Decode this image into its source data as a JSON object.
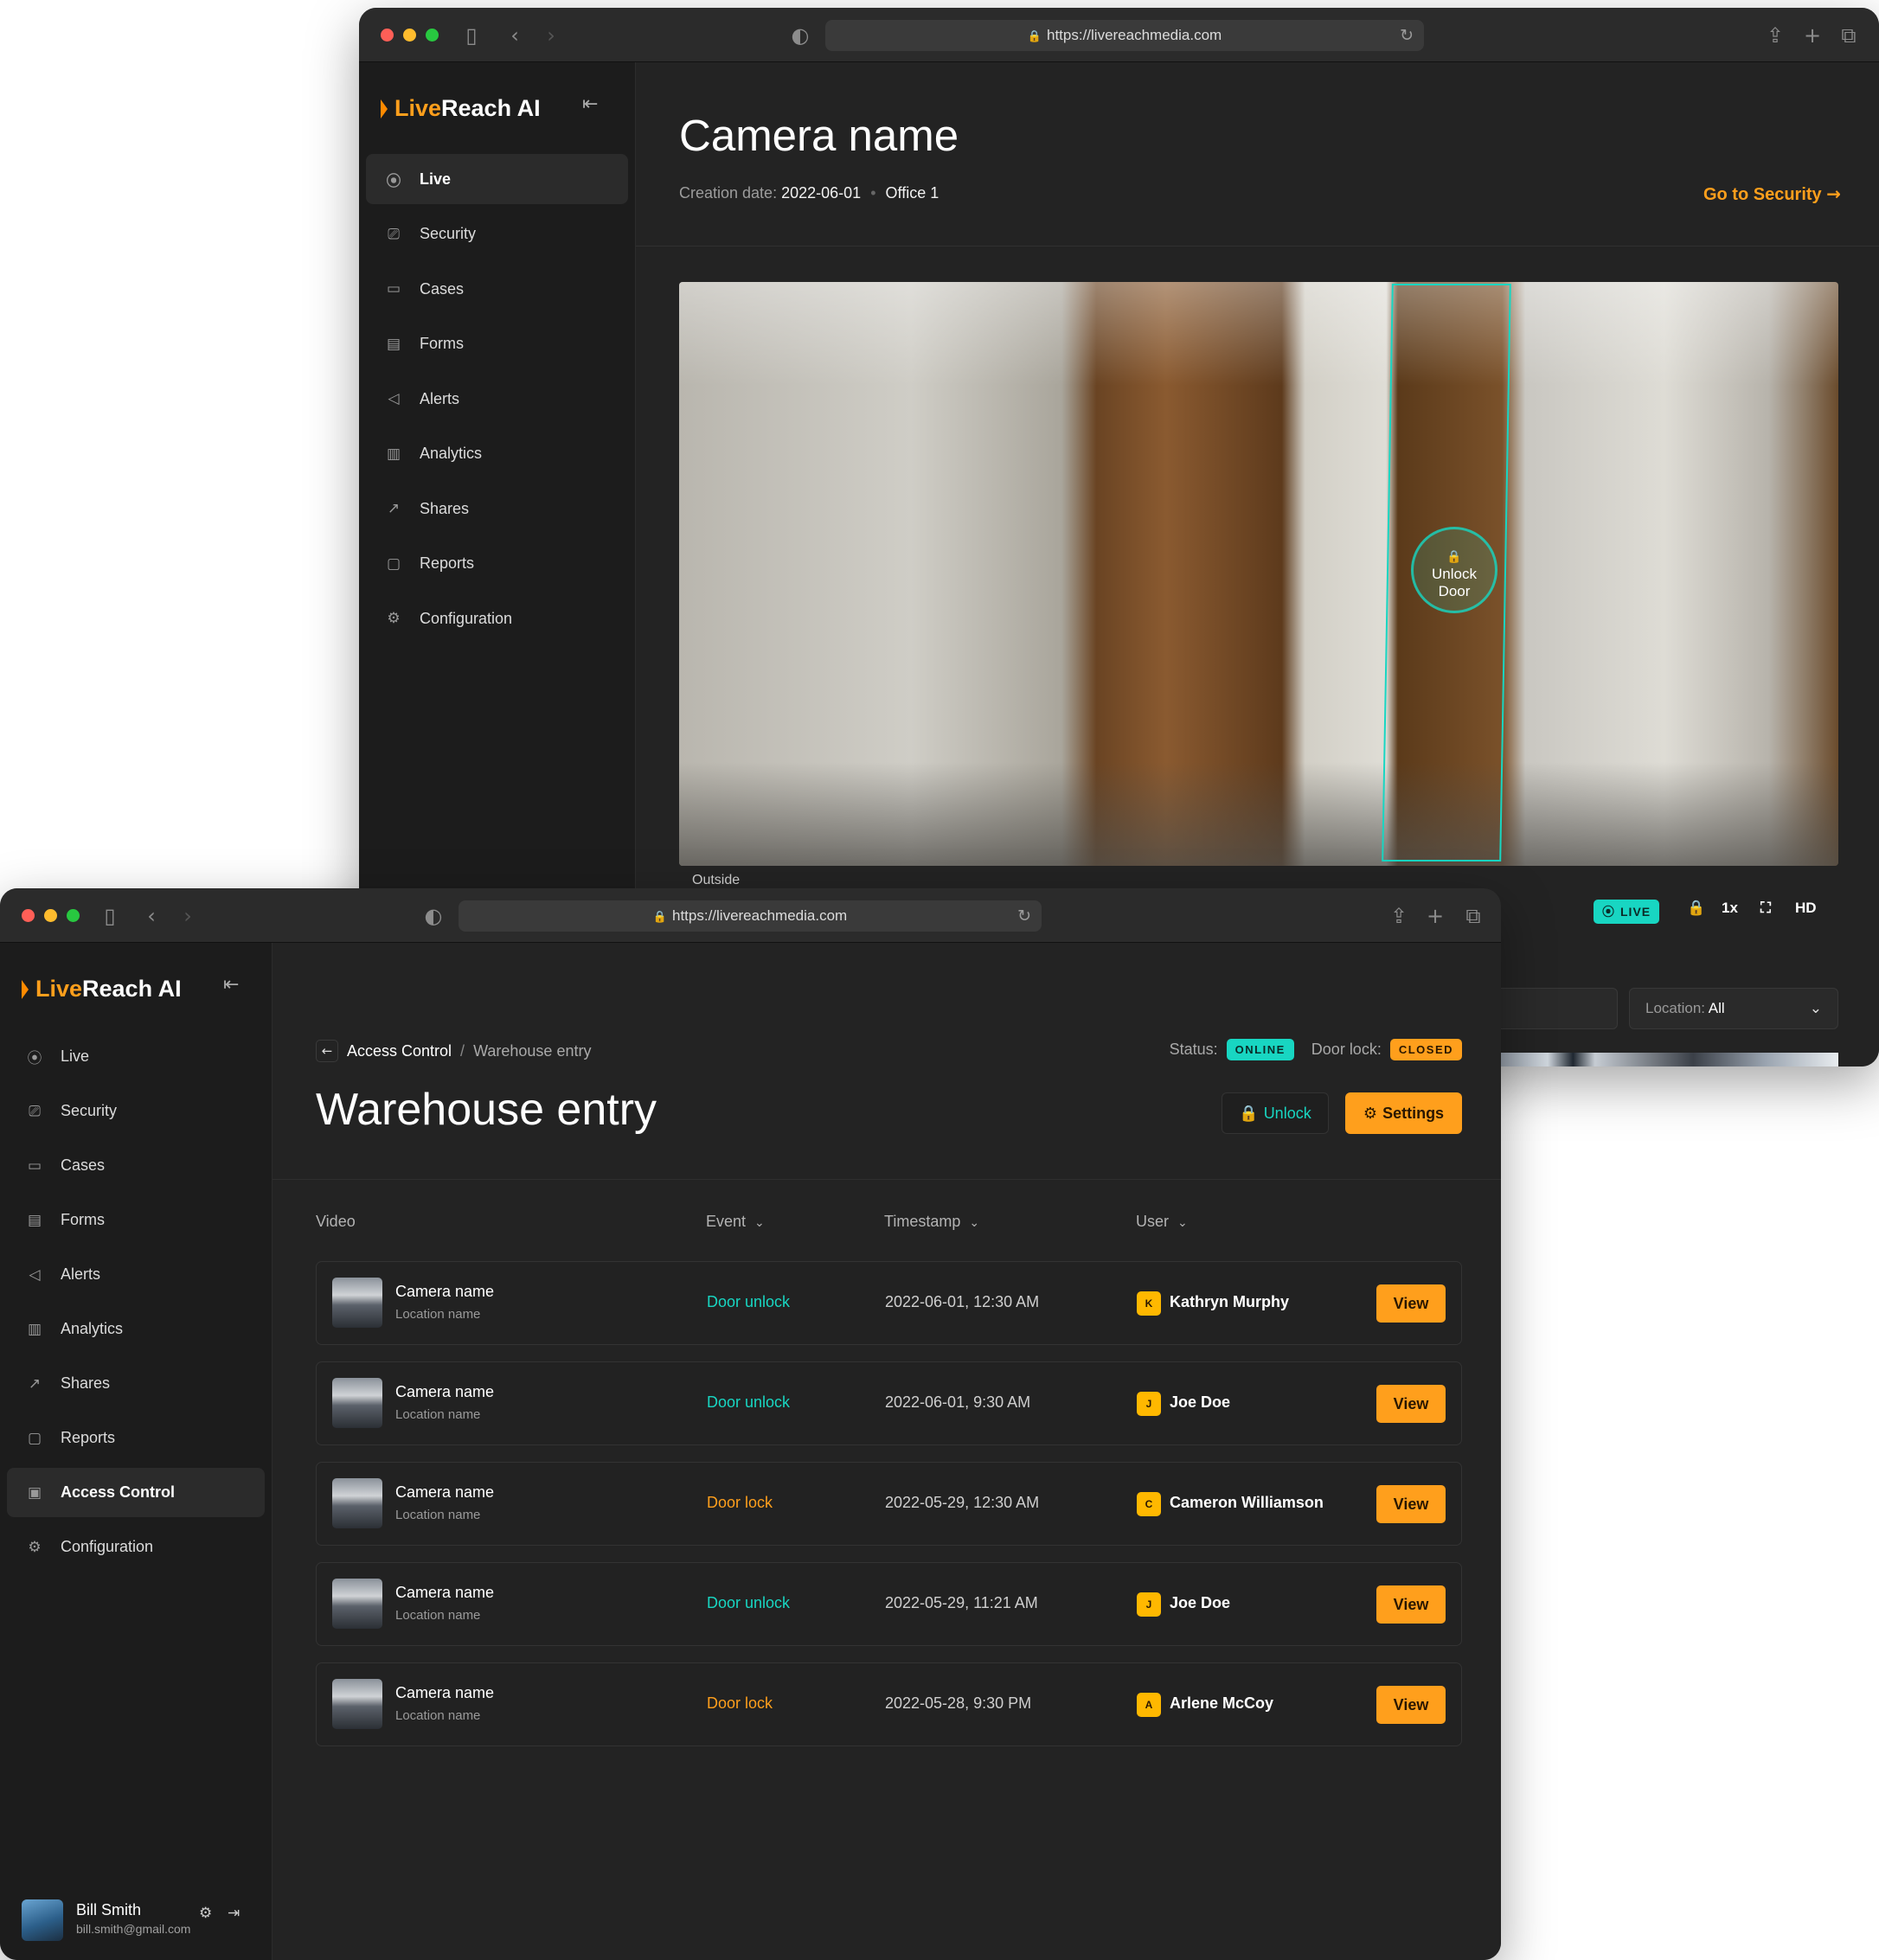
{
  "back_window": {
    "url": "https://livereachmedia.com",
    "brand_prefix": "Live",
    "brand_suffix": "Reach AI",
    "nav": [
      {
        "label": "Live",
        "icon": "live-icon"
      },
      {
        "label": "Security",
        "icon": "camera-icon"
      },
      {
        "label": "Cases",
        "icon": "folder-icon"
      },
      {
        "label": "Forms",
        "icon": "form-icon"
      },
      {
        "label": "Alerts",
        "icon": "megaphone-icon"
      },
      {
        "label": "Analytics",
        "icon": "bar-chart-icon"
      },
      {
        "label": "Shares",
        "icon": "share-icon"
      },
      {
        "label": "Reports",
        "icon": "report-icon"
      },
      {
        "label": "Configuration",
        "icon": "gear-icon"
      }
    ],
    "active_nav": "Live",
    "title": "Camera name",
    "creation_label": "Creation date:",
    "creation_date": "2022-06-01",
    "office": "Office 1",
    "go_security": "Go to Security",
    "unlock_overlay_line1": "Unlock",
    "unlock_overlay_line2": "Door",
    "camera_label": "Outside",
    "controls": {
      "live": "LIVE",
      "speed": "1x",
      "quality": "HD"
    },
    "location_filter_label": "Location:",
    "location_filter_value": "All"
  },
  "front_window": {
    "url": "https://livereachmedia.com",
    "brand_prefix": "Live",
    "brand_suffix": "Reach AI",
    "nav": [
      {
        "label": "Live",
        "icon": "live-icon"
      },
      {
        "label": "Security",
        "icon": "camera-icon"
      },
      {
        "label": "Cases",
        "icon": "folder-icon"
      },
      {
        "label": "Forms",
        "icon": "form-icon"
      },
      {
        "label": "Alerts",
        "icon": "megaphone-icon"
      },
      {
        "label": "Analytics",
        "icon": "bar-chart-icon"
      },
      {
        "label": "Shares",
        "icon": "share-icon"
      },
      {
        "label": "Reports",
        "icon": "report-icon"
      },
      {
        "label": "Access Control",
        "icon": "door-icon"
      },
      {
        "label": "Configuration",
        "icon": "gear-icon"
      }
    ],
    "active_nav": "Access Control",
    "breadcrumb": {
      "parent": "Access Control",
      "separator": "/",
      "current": "Warehouse entry"
    },
    "status_label": "Status:",
    "status_value": "ONLINE",
    "door_lock_label": "Door lock:",
    "door_lock_value": "CLOSED",
    "title": "Warehouse entry",
    "unlock_button": "Unlock",
    "settings_button": "Settings",
    "table": {
      "columns": [
        "Video",
        "Event",
        "Timestamp",
        "User"
      ],
      "rows": [
        {
          "camera": "Camera name",
          "location": "Location name",
          "event": "Door unlock",
          "event_type": "unlock",
          "timestamp": "2022-06-01, 12:30 AM",
          "user_initial": "K",
          "user": "Kathryn Murphy",
          "action": "View"
        },
        {
          "camera": "Camera name",
          "location": "Location name",
          "event": "Door unlock",
          "event_type": "unlock",
          "timestamp": "2022-06-01, 9:30 AM",
          "user_initial": "J",
          "user": "Joe Doe",
          "action": "View"
        },
        {
          "camera": "Camera name",
          "location": "Location name",
          "event": "Door lock",
          "event_type": "lock",
          "timestamp": "2022-05-29, 12:30 AM",
          "user_initial": "C",
          "user": "Cameron Williamson",
          "action": "View"
        },
        {
          "camera": "Camera name",
          "location": "Location name",
          "event": "Door unlock",
          "event_type": "unlock",
          "timestamp": "2022-05-29, 11:21 AM",
          "user_initial": "J",
          "user": "Joe Doe",
          "action": "View"
        },
        {
          "camera": "Camera name",
          "location": "Location name",
          "event": "Door lock",
          "event_type": "lock",
          "timestamp": "2022-05-28, 9:30 PM",
          "user_initial": "A",
          "user": "Arlene McCoy",
          "action": "View"
        }
      ]
    },
    "user": {
      "name": "Bill Smith",
      "email": "bill.smith@gmail.com"
    }
  },
  "colors": {
    "accent": "#ff9f1c",
    "teal": "#18d6c2",
    "background": "#232323",
    "sidebar": "#1c1c1c"
  }
}
